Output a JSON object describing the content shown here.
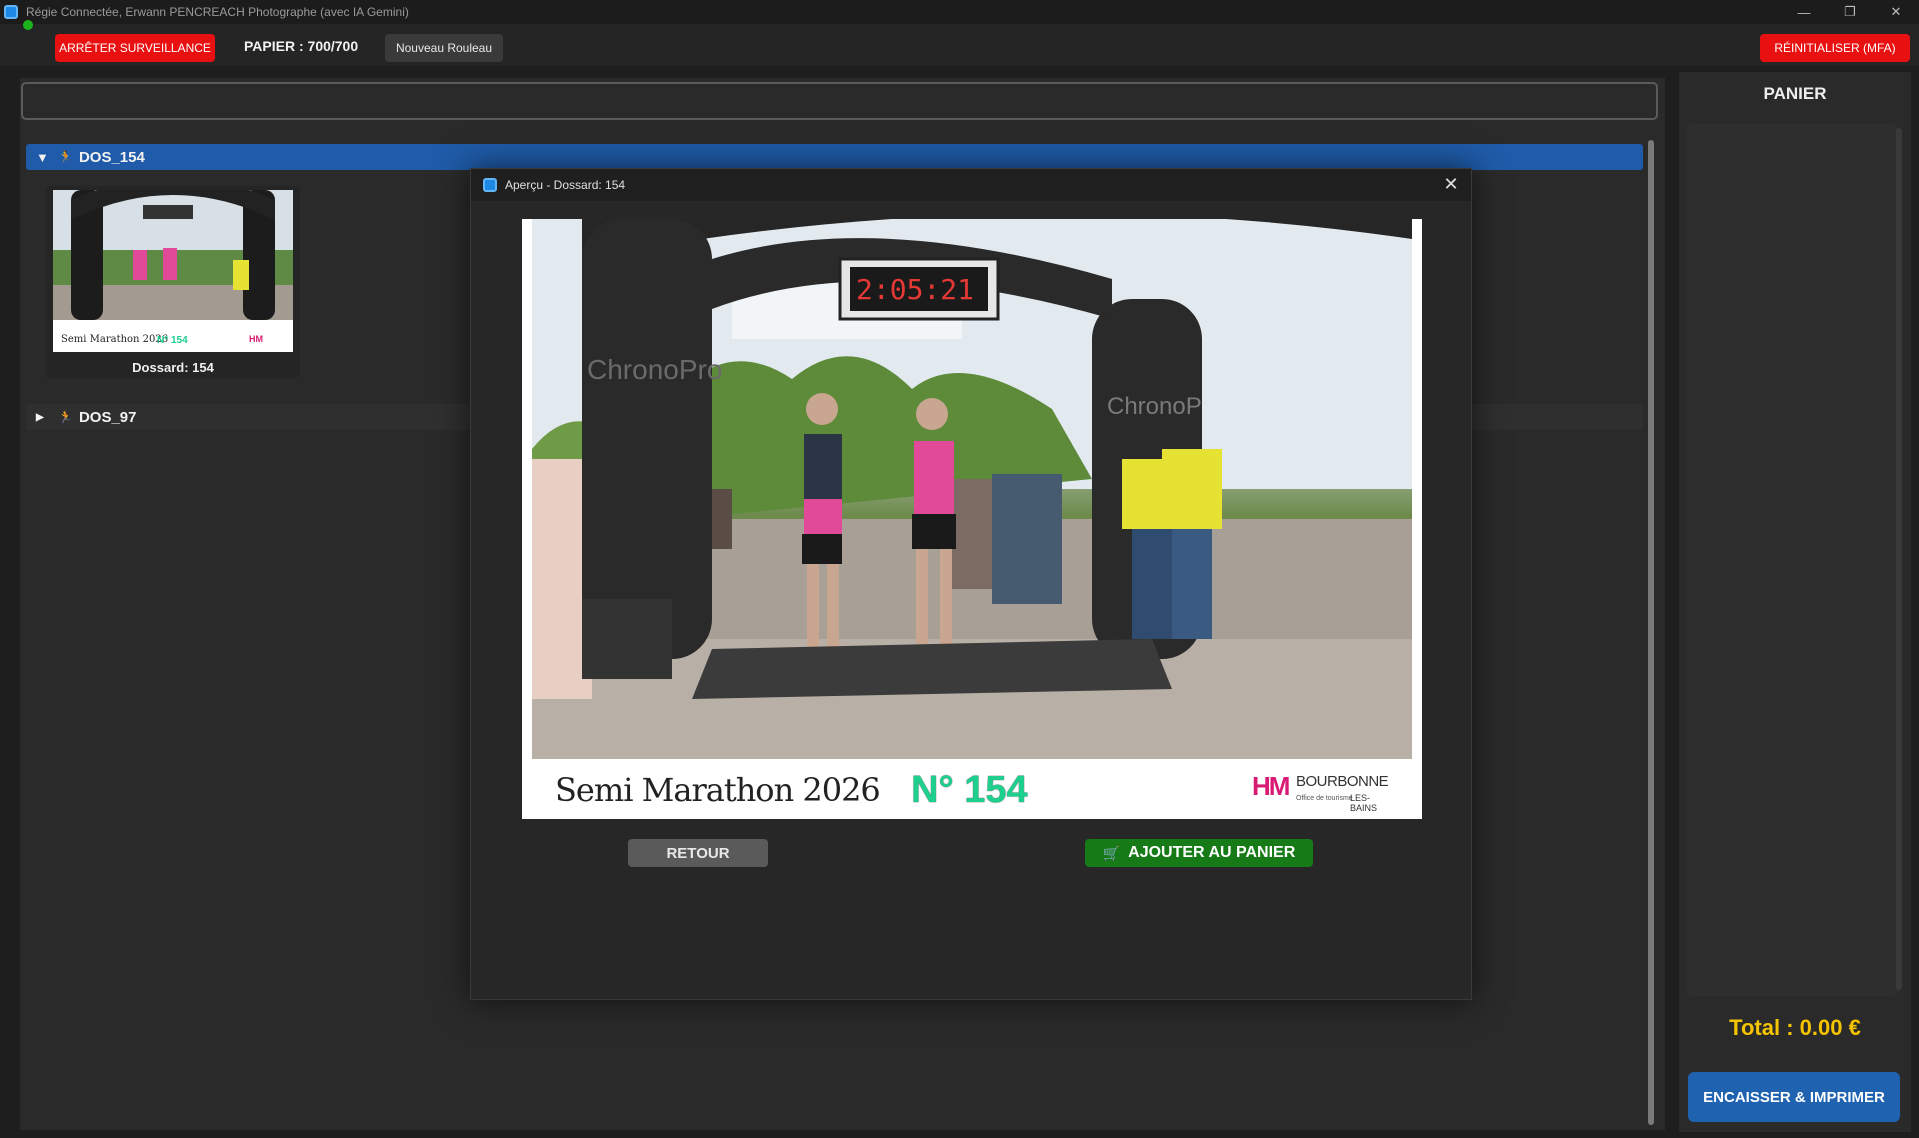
{
  "window": {
    "title": "Régie Connectée, Erwann PENCREACH Photographe (avec IA Gemini)",
    "minimize_icon": "—",
    "restore_icon": "❐",
    "close_icon": "✕"
  },
  "toolbar": {
    "stop_label": "ARRÊTER SURVEILLANCE",
    "paper_label": "PAPIER : 700/700",
    "new_roll_label": "Nouveau Rouleau",
    "reset_label": "RÉINITIALISER (MFA)"
  },
  "search": {
    "placeholder": ""
  },
  "groups": [
    {
      "arrow": "▼",
      "runner": "🏃",
      "label": "DOS_154",
      "expanded": true
    },
    {
      "arrow": "▶",
      "runner": "🏃",
      "label": "DOS_97",
      "expanded": false
    }
  ],
  "thumbnail": {
    "caption": "Dossard: 154"
  },
  "cart": {
    "title": "PANIER",
    "total": "Total : 0.00 €",
    "checkout_label": "ENCAISSER & IMPRIMER"
  },
  "modal": {
    "title": "Aperçu - Dossard: 154",
    "close_icon": "✕",
    "back_label": "RETOUR",
    "add_label": "AJOUTER AU PANIER",
    "add_icon": "🛒",
    "photo_caption": {
      "event": "Semi Marathon 2026",
      "bib": "N° 154",
      "logo_mark": "HM",
      "logo_name": "BOURBONNE",
      "logo_sub": "Office de tourisme",
      "logo_sub2": "LES-BAINS"
    }
  },
  "colors": {
    "accent_blue": "#1f5ba8",
    "danger_red": "#e81010",
    "success_green": "#167a16",
    "total_yellow": "#f5c400",
    "status_green": "#1db31d"
  }
}
